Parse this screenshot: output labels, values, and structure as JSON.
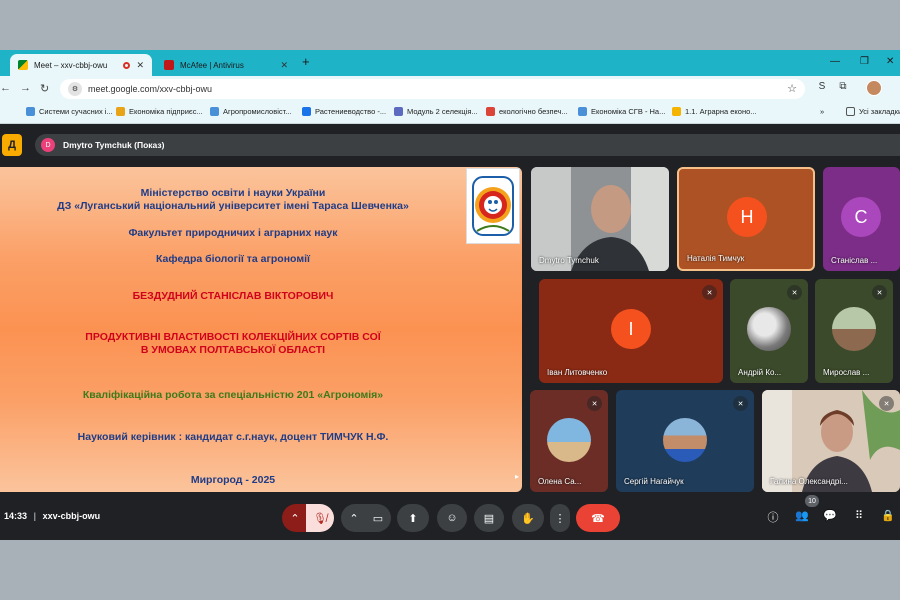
{
  "browser": {
    "tabs": [
      {
        "label": "Meet – xxv-cbbj-owu",
        "close": "✕"
      },
      {
        "label": "McAfee | Antivirus",
        "close": "✕"
      }
    ],
    "new_tab": "+",
    "window_controls": [
      "—",
      "❐",
      "✕"
    ],
    "address": "meet.google.com/xxv-cbbj-owu",
    "bookmarks": [
      {
        "label": "Системи сучасних і...",
        "color": "#4a90d9"
      },
      {
        "label": "Економіка підприєс...",
        "color": "#e8a317"
      },
      {
        "label": "Агропромисловіст...",
        "color": "#4a90d9"
      },
      {
        "label": "Растениеводство -...",
        "color": "#1a73e8"
      },
      {
        "label": "Модуль 2 селекція...",
        "color": "#5c6bc0"
      },
      {
        "label": "екологічно безпеч...",
        "color": "#db4437"
      },
      {
        "label": "Економіка СГВ - На...",
        "color": "#4a90d9"
      },
      {
        "label": "1.1. Аграрна еконо...",
        "color": "#f4b400"
      }
    ],
    "bookmarks_more": "»",
    "all_bookmarks": "Усі закладки"
  },
  "meet": {
    "presenting_badge": "Д",
    "presenter": {
      "initial": "D",
      "label": "Dmytro Tymchuk (Показ)"
    },
    "slide": {
      "lines": [
        "Міністерство освіти і науки України",
        "ДЗ «Луганський національний університет імені Тараса Шевченка»",
        "Факультет природничих і аграрних наук",
        "Кафедра біології та агрономії",
        "БЕЗДУДНИЙ СТАНІСЛАВ ВІКТОРОВИЧ",
        "ПРОДУКТИВНІ ВЛАСТИВОСТІ КОЛЕКЦІЙНИХ СОРТІВ СОЇ",
        "В УМОВАХ ПОЛТАВСЬКОЇ ОБЛАСТІ",
        "Кваліфікаційна робота за спеціальністю 201 «Агрономія»",
        "Науковий керівник : кандидат с.г.наук, доцент ТИМЧУК Н.Ф.",
        "Миргород - 2025"
      ]
    },
    "participants": [
      {
        "name": "Dmytro Tymchuk"
      },
      {
        "name": "Наталія Тимчук",
        "initial": "Н",
        "color": "#f4511e"
      },
      {
        "name": "Станіслав ...",
        "initial": "С",
        "color": "#ab47bc"
      },
      {
        "name": "Іван Литовченко",
        "initial": "І",
        "color": "#f4511e"
      },
      {
        "name": "Андрій Ко..."
      },
      {
        "name": "Мирослав ..."
      },
      {
        "name": "Олена Са..."
      },
      {
        "name": "Сергій Нагайчук"
      },
      {
        "name": "Галина Олександрі..."
      }
    ],
    "time": "14:33",
    "meeting_code": "xxv-cbbj-owu",
    "separator": "|",
    "people_count": "10"
  }
}
